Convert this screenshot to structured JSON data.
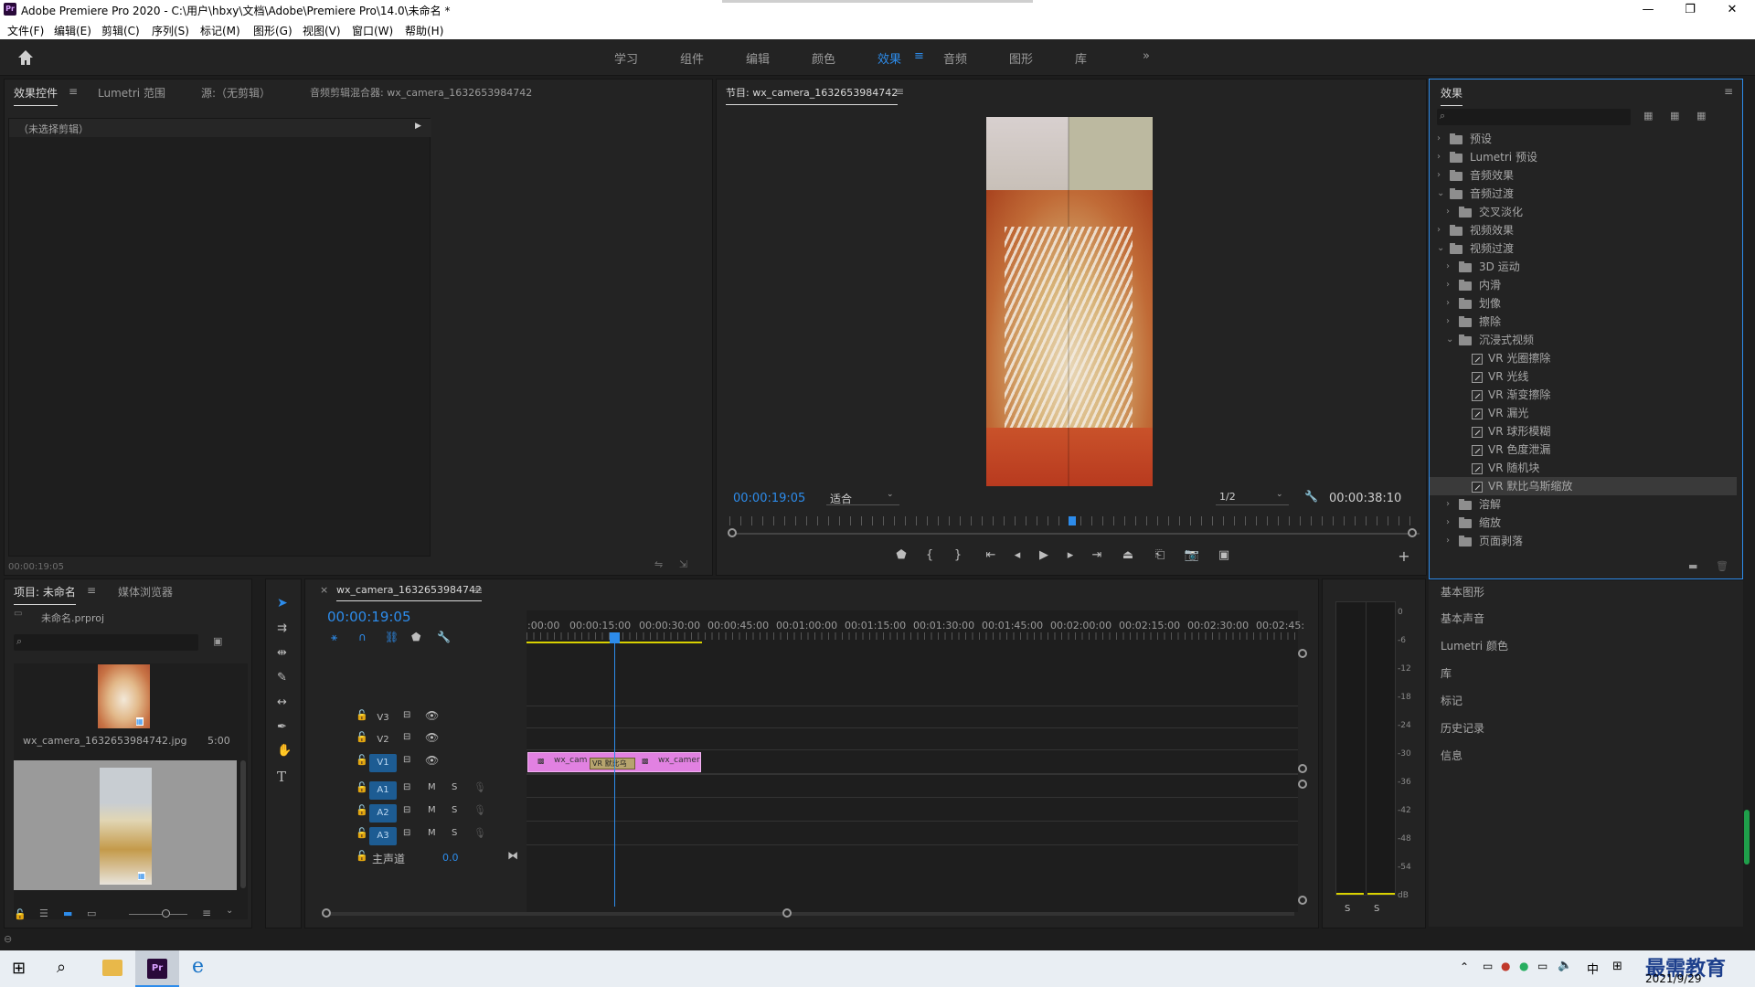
{
  "app": {
    "title": "Adobe Premiere Pro 2020 - C:\\用户\\hbxy\\文档\\Adobe\\Premiere Pro\\14.0\\未命名 *",
    "icon_text": "Pr",
    "window_controls": {
      "minimize": "—",
      "maximize": "❐",
      "close": "✕"
    }
  },
  "menu": [
    "文件(F)",
    "编辑(E)",
    "剪辑(C)",
    "序列(S)",
    "标记(M)",
    "图形(G)",
    "视图(V)",
    "窗口(W)",
    "帮助(H)"
  ],
  "workspaces": {
    "tabs": [
      "学习",
      "组件",
      "编辑",
      "颜色",
      "效果",
      "音频",
      "图形",
      "库"
    ],
    "active": "效果",
    "more": "»"
  },
  "source_panel": {
    "tabs": [
      "效果控件",
      "Lumetri 范围",
      "源:（无剪辑）",
      "音频剪辑混合器: wx_camera_1632653984742"
    ],
    "active_tab": "效果控件",
    "clip_label": "（未选择剪辑）",
    "timecode": "00:00:19:05"
  },
  "program_panel": {
    "title": "节目: wx_camera_1632653984742",
    "timecode": "00:00:19:05",
    "fit": "适合",
    "resolution": "1/2",
    "duration": "00:00:38:10",
    "playhead_fraction": 0.5
  },
  "effects_panel": {
    "title": "效果",
    "search_placeholder": "",
    "tree": [
      {
        "label": "预设",
        "level": 0,
        "expanded": false,
        "kind": "folder-special"
      },
      {
        "label": "Lumetri 预设",
        "level": 0,
        "expanded": false,
        "kind": "folder-special"
      },
      {
        "label": "音频效果",
        "level": 0,
        "expanded": false,
        "kind": "folder"
      },
      {
        "label": "音频过渡",
        "level": 0,
        "expanded": true,
        "kind": "folder"
      },
      {
        "label": "交叉淡化",
        "level": 1,
        "expanded": false,
        "kind": "folder"
      },
      {
        "label": "视频效果",
        "level": 0,
        "expanded": false,
        "kind": "folder"
      },
      {
        "label": "视频过渡",
        "level": 0,
        "expanded": true,
        "kind": "folder"
      },
      {
        "label": "3D 运动",
        "level": 1,
        "expanded": false,
        "kind": "folder"
      },
      {
        "label": "内滑",
        "level": 1,
        "expanded": false,
        "kind": "folder"
      },
      {
        "label": "划像",
        "level": 1,
        "expanded": false,
        "kind": "folder"
      },
      {
        "label": "擦除",
        "level": 1,
        "expanded": false,
        "kind": "folder"
      },
      {
        "label": "沉浸式视频",
        "level": 1,
        "expanded": true,
        "kind": "folder"
      },
      {
        "label": "VR 光圈擦除",
        "level": 2,
        "kind": "effect"
      },
      {
        "label": "VR 光线",
        "level": 2,
        "kind": "effect"
      },
      {
        "label": "VR 渐变擦除",
        "level": 2,
        "kind": "effect"
      },
      {
        "label": "VR 漏光",
        "level": 2,
        "kind": "effect"
      },
      {
        "label": "VR 球形模糊",
        "level": 2,
        "kind": "effect"
      },
      {
        "label": "VR 色度泄漏",
        "level": 2,
        "kind": "effect"
      },
      {
        "label": "VR 随机块",
        "level": 2,
        "kind": "effect"
      },
      {
        "label": "VR 默比乌斯缩放",
        "level": 2,
        "kind": "effect",
        "selected": true
      },
      {
        "label": "溶解",
        "level": 1,
        "expanded": false,
        "kind": "folder"
      },
      {
        "label": "缩放",
        "level": 1,
        "expanded": false,
        "kind": "folder"
      },
      {
        "label": "页面剥落",
        "level": 1,
        "expanded": false,
        "kind": "folder"
      }
    ]
  },
  "side_panels": [
    "基本图形",
    "基本声音",
    "Lumetri 颜色",
    "库",
    "标记",
    "历史记录",
    "信息"
  ],
  "project_panel": {
    "tabs": [
      "项目: 未命名",
      "媒体浏览器"
    ],
    "project_file": "未命名.prproj",
    "items": [
      {
        "name": "wx_camera_1632653984742.jpg",
        "duration": "5:00"
      }
    ]
  },
  "timeline": {
    "sequence_tab": "wx_camera_1632653984742",
    "timecode": "00:00:19:05",
    "ruler": [
      ":00:00",
      "00:00:15:00",
      "00:00:30:00",
      "00:00:45:00",
      "00:01:00:00",
      "00:01:15:00",
      "00:01:30:00",
      "00:01:45:00",
      "00:02:00:00",
      "00:02:15:00",
      "00:02:30:00",
      "00:02:45:"
    ],
    "video_tracks": [
      "V3",
      "V2",
      "V1"
    ],
    "audio_tracks": [
      "A1",
      "A2",
      "A3"
    ],
    "master": {
      "label": "主声道",
      "value": "0.0"
    },
    "clips": [
      {
        "label": "wx_cam",
        "track": "V1"
      },
      {
        "label": "wx_camer",
        "track": "V1"
      }
    ],
    "transition_label": "VR 默比乌",
    "track_buttons": {
      "mute": "M",
      "solo": "S"
    }
  },
  "audio_meter": {
    "scale": [
      "0",
      "-6",
      "-12",
      "-18",
      "-24",
      "-30",
      "-36",
      "-42",
      "-48",
      "-54",
      "dB"
    ],
    "solo_left": "S",
    "solo_right": "S"
  },
  "taskbar": {
    "clock_date": "2021/9/29",
    "ime": "中",
    "watermark": "最需教育"
  }
}
